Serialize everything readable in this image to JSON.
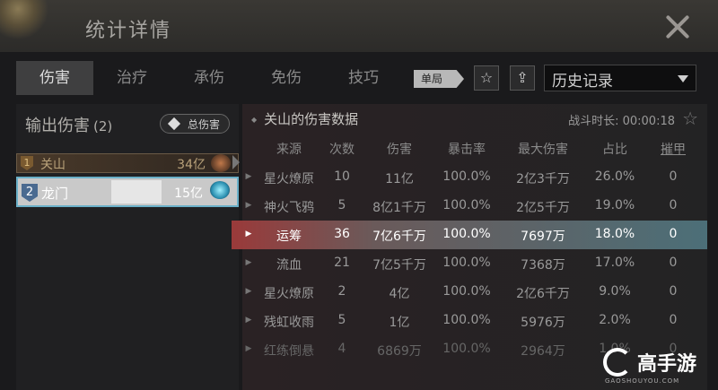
{
  "window": {
    "title": "统计详情"
  },
  "tabs": [
    {
      "label": "伤害",
      "active": true
    },
    {
      "label": "治疗",
      "active": false
    },
    {
      "label": "承伤",
      "active": false
    },
    {
      "label": "免伤",
      "active": false
    },
    {
      "label": "技巧",
      "active": false
    }
  ],
  "toolbar": {
    "single_label": "单局",
    "history_label": "历史记录"
  },
  "left": {
    "title": "输出伤害",
    "count": "(2)",
    "total_button": "总伤害",
    "rows": [
      {
        "rank": "1",
        "name": "关山",
        "value": "34亿"
      },
      {
        "rank": "2",
        "name": "龙门",
        "value": "15亿"
      }
    ]
  },
  "main": {
    "title": "关山的伤害数据",
    "battle_time": "战斗时长: 00:00:18",
    "columns": [
      "来源",
      "次数",
      "伤害",
      "暴击率",
      "最大伤害",
      "占比",
      "摧甲"
    ],
    "rows": [
      [
        "星火燎原",
        "10",
        "11亿",
        "100.0%",
        "2亿3千万",
        "26.0%",
        "0"
      ],
      [
        "神火飞鸦",
        "5",
        "8亿1千万",
        "100.0%",
        "2亿5千万",
        "19.0%",
        "0"
      ],
      [
        "运筹",
        "36",
        "7亿6千万",
        "100.0%",
        "7697万",
        "18.0%",
        "0"
      ],
      [
        "流血",
        "21",
        "7亿5千万",
        "100.0%",
        "7368万",
        "17.0%",
        "0"
      ],
      [
        "星火燎原",
        "2",
        "4亿",
        "100.0%",
        "2亿6千万",
        "9.0%",
        "0"
      ],
      [
        "残虹收雨",
        "5",
        "1亿",
        "100.0%",
        "5976万",
        "2.0%",
        "0"
      ],
      [
        "红练倒悬",
        "4",
        "6869万",
        "100.0%",
        "2964万",
        "1.0%",
        "0"
      ]
    ]
  },
  "watermark": {
    "text": "高手游",
    "domain": "GAOSHOUYOU.COM"
  }
}
